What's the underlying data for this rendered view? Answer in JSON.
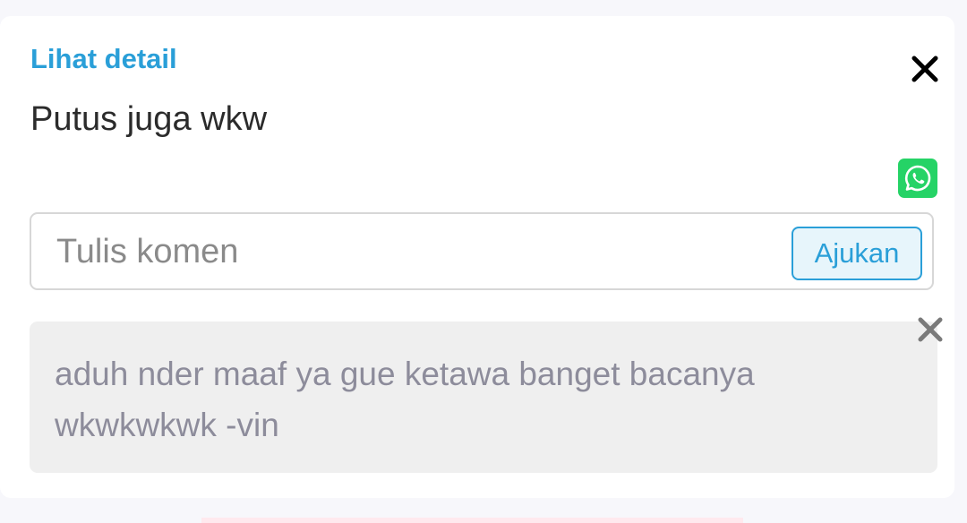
{
  "post": {
    "detail_link": "Lihat detail",
    "text": "Putus juga wkw"
  },
  "icons": {
    "close": "close-icon",
    "share": "whatsapp-icon",
    "delete": "delete-icon"
  },
  "comment_form": {
    "placeholder": "Tulis komen",
    "value": "",
    "submit_label": "Ajukan"
  },
  "comments": [
    {
      "text": "aduh nder maaf ya gue ketawa banget bacanya wkwkwkwk -vin"
    }
  ],
  "colors": {
    "accent": "#2a9fd8",
    "whatsapp": "#25d366",
    "comment_bg": "#efefef",
    "comment_text": "#8d8c9b"
  }
}
